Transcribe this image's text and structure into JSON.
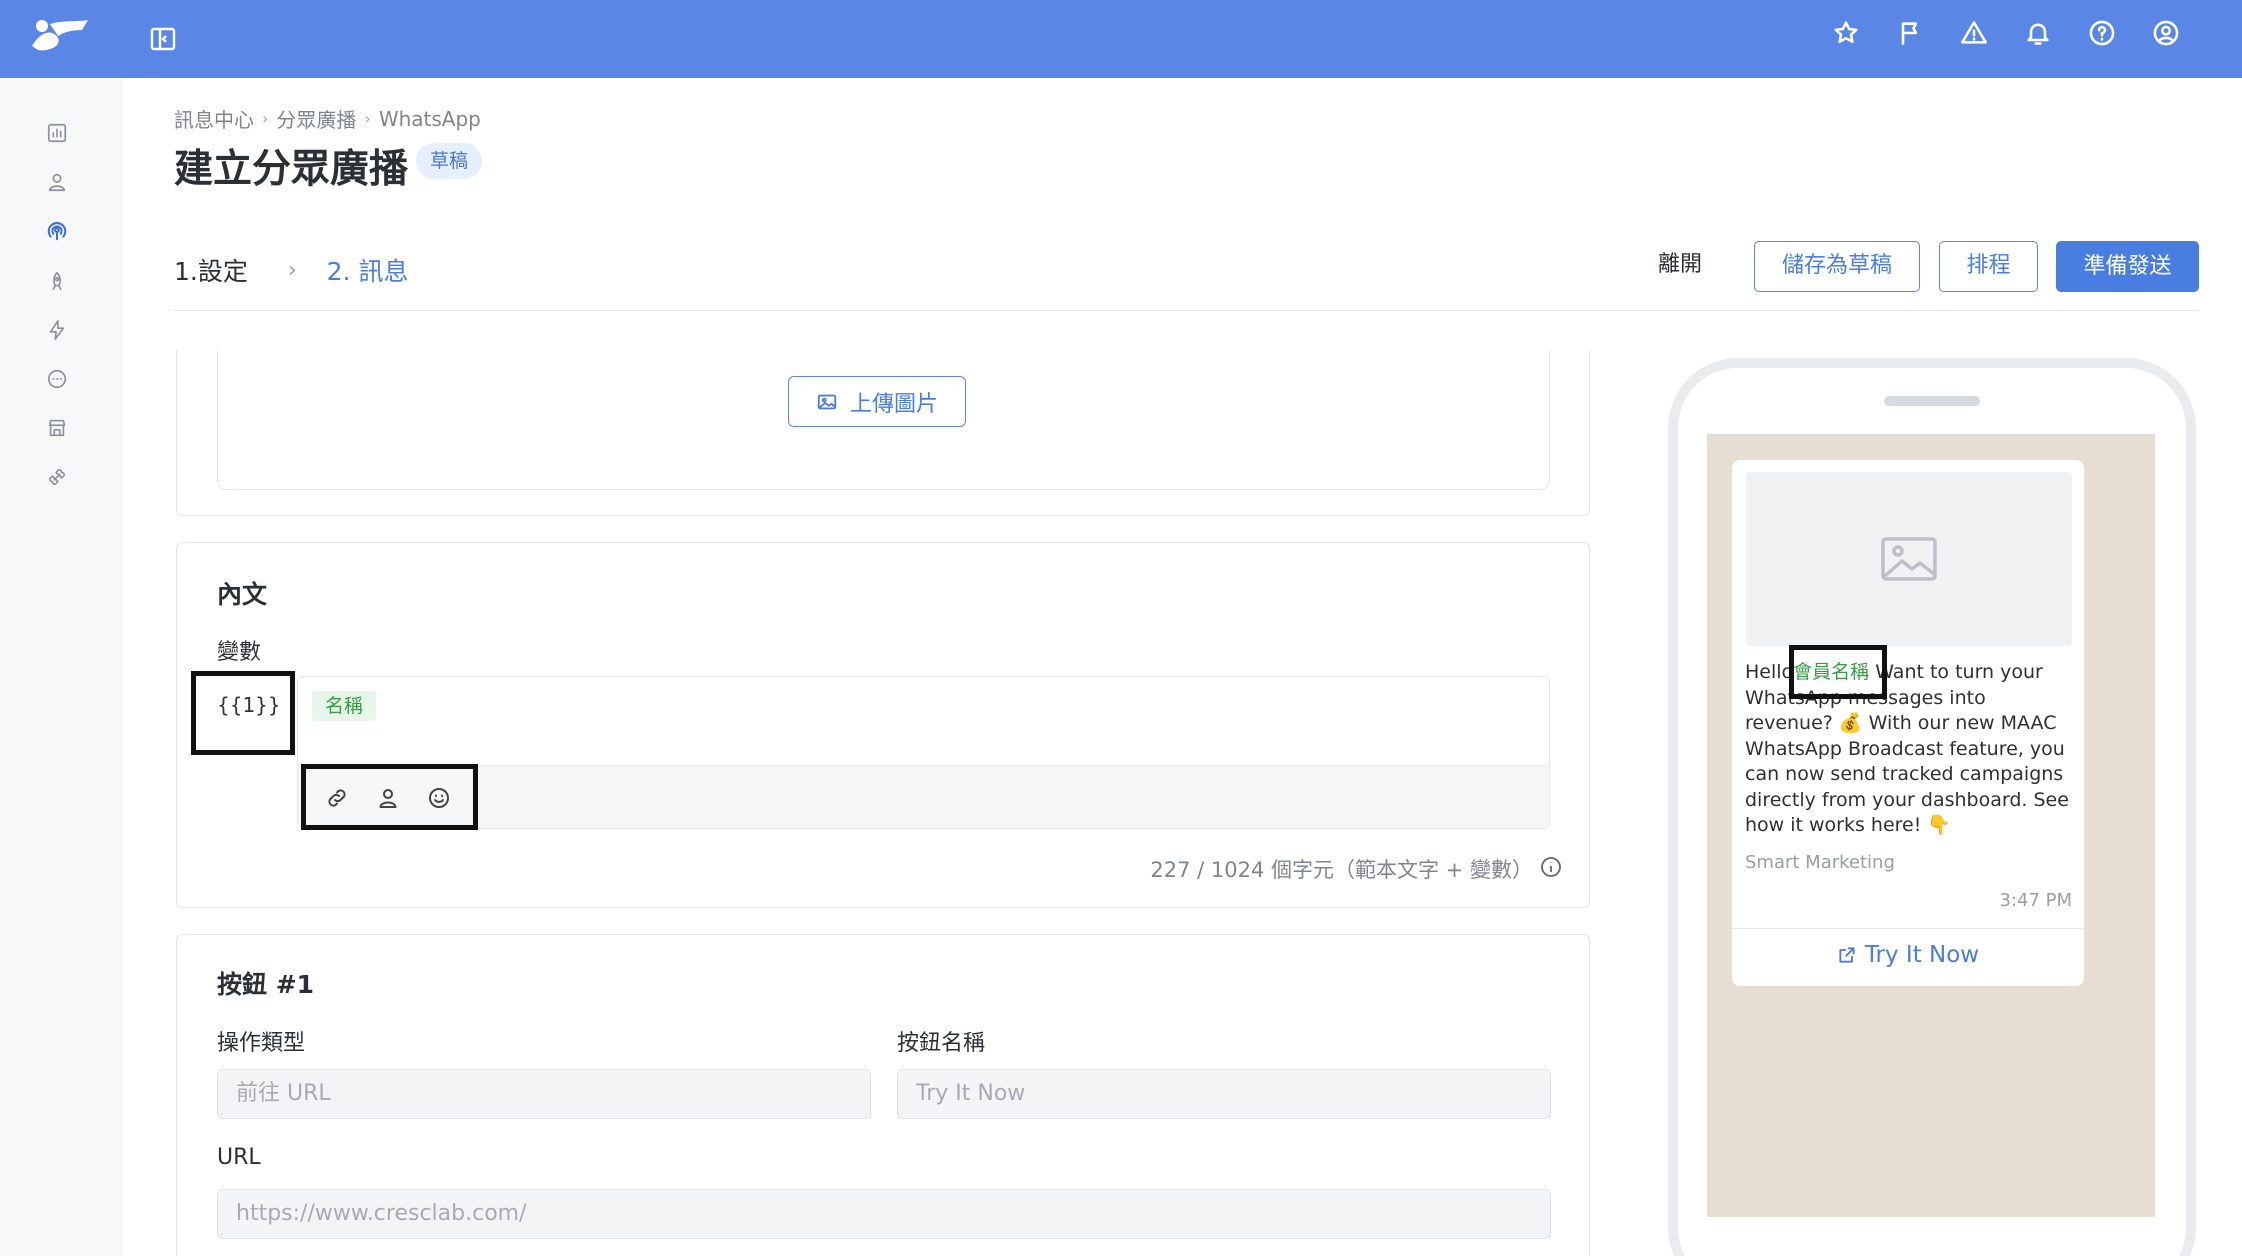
{
  "topbar": {
    "icons": [
      "star-icon",
      "flag-icon",
      "warning-icon",
      "bell-icon",
      "help-icon",
      "user-circle-icon"
    ]
  },
  "sidebar": {
    "items": [
      "chart-icon",
      "user-icon",
      "broadcast-icon",
      "rocket-icon",
      "bolt-icon",
      "chat-icon",
      "store-icon",
      "integration-icon"
    ],
    "active": "broadcast-icon"
  },
  "breadcrumb": [
    "訊息中心",
    "分眾廣播",
    "WhatsApp"
  ],
  "page": {
    "title": "建立分眾廣播",
    "badge": "草稿"
  },
  "steps": {
    "step1": "1.設定",
    "step2": "2. 訊息"
  },
  "actions": {
    "leave": "離開",
    "save_draft": "儲存為草稿",
    "schedule": "排程",
    "ready_send": "準備發送"
  },
  "upload": {
    "label": "上傳圖片"
  },
  "body_section": {
    "title": "內文",
    "variables_label": "變數",
    "variable_token": "{{1}}",
    "name_tag": "名稱",
    "char_count": "227 / 1024 個字元（範本文字 + 變數）",
    "toolbar": [
      "link-icon",
      "user-icon",
      "emoji-icon"
    ]
  },
  "button_section": {
    "title": "按鈕 #1",
    "action_type_label": "操作類型",
    "action_type_value": "前往 URL",
    "button_name_label": "按鈕名稱",
    "button_name_value": "Try It Now",
    "url_label": "URL",
    "url_value": "https://www.cresclab.com/"
  },
  "preview": {
    "greeting": "Hello",
    "name_var": "會員名稱",
    "message_rest": " Want to turn your WhatsApp messages into revenue? 💰 With our new MAAC WhatsApp Broadcast feature, you can now send tracked campaigns directly from your dashboard. See how it works here! 👇",
    "footer": "Smart Marketing",
    "time": "3:47 PM",
    "cta": "Try It Now"
  },
  "colors": {
    "topbar": "#5a87e6",
    "primary": "#4a7de0",
    "tag_green": "#32a043"
  }
}
